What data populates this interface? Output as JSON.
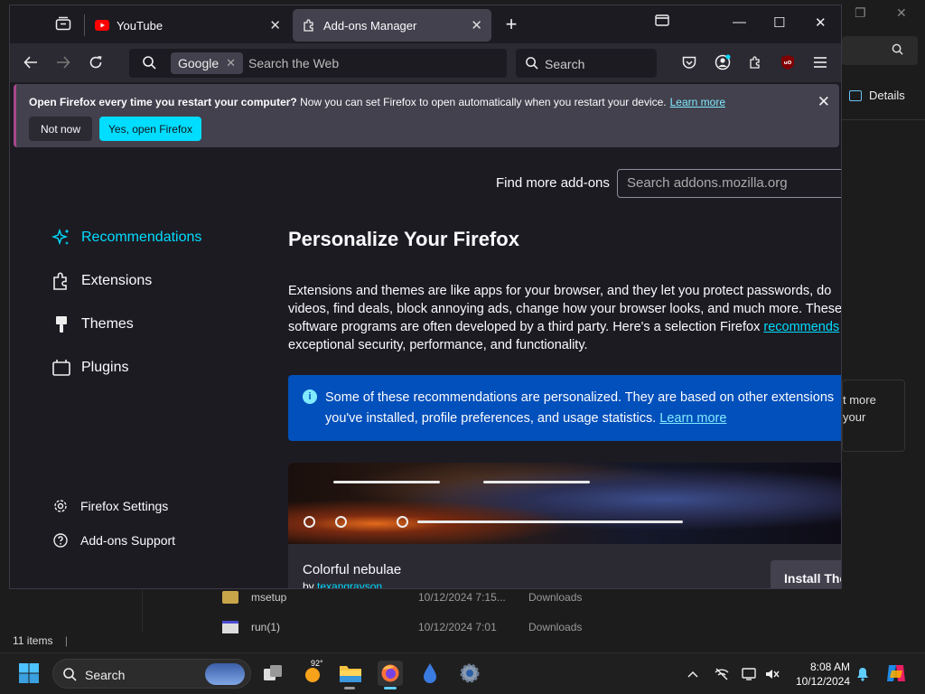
{
  "background": {
    "details_label": "Details",
    "panel_text_1": "t more",
    "panel_text_2": "your",
    "files": [
      {
        "name": "msetup",
        "date": "10/12/2024 7:15...",
        "type": "Downloads"
      },
      {
        "name": "run(1)",
        "date": "10/12/2024 7:01",
        "type": "Downloads"
      }
    ],
    "status": "11 items"
  },
  "tabs": [
    {
      "title": "YouTube",
      "icon": "youtube-icon"
    },
    {
      "title": "Add-ons Manager",
      "icon": "puzzle-icon"
    }
  ],
  "navbar": {
    "search_engine": "Google",
    "url_placeholder": "Search the Web",
    "search_placeholder": "Search"
  },
  "notification": {
    "bold": "Open Firefox every time you restart your computer?",
    "text": " Now you can set Firefox to open automatically when you restart your device.",
    "link": "Learn more",
    "not_now": "Not now",
    "yes": "Yes, open Firefox"
  },
  "addons": {
    "find_label": "Find more add-ons",
    "find_placeholder": "Search addons.mozilla.org",
    "categories": [
      {
        "label": "Recommendations",
        "active": true
      },
      {
        "label": "Extensions",
        "active": false
      },
      {
        "label": "Themes",
        "active": false
      },
      {
        "label": "Plugins",
        "active": false
      }
    ],
    "footer": [
      {
        "label": "Firefox Settings"
      },
      {
        "label": "Add-ons Support"
      }
    ],
    "title": "Personalize Your Firefox",
    "description_start": "Extensions and themes are like apps for your browser, and they let you protect passwords, do videos, find deals, block annoying ads, change how your browser looks, and much more. These software programs are often developed by a third party. Here's a selection Firefox ",
    "description_link": "recommends",
    "description_end": " for exceptional security, performance, and functionality.",
    "info_text": "Some of these recommendations are personalized. They are based on other extensions you've installed, profile preferences, and usage statistics.",
    "info_link": "Learn more",
    "theme": {
      "name": "Colorful nebulae",
      "by_prefix": "by ",
      "author": "texangrayson",
      "install_label": "Install Theme"
    }
  },
  "taskbar": {
    "search_label": "Search",
    "weather_temp": "92°",
    "time": "8:08 AM",
    "date": "10/12/2024"
  },
  "colors": {
    "accent": "#00ddff",
    "info_bg": "#0250bb",
    "notif_bg": "#42414d",
    "page_bg": "#1c1b22"
  }
}
